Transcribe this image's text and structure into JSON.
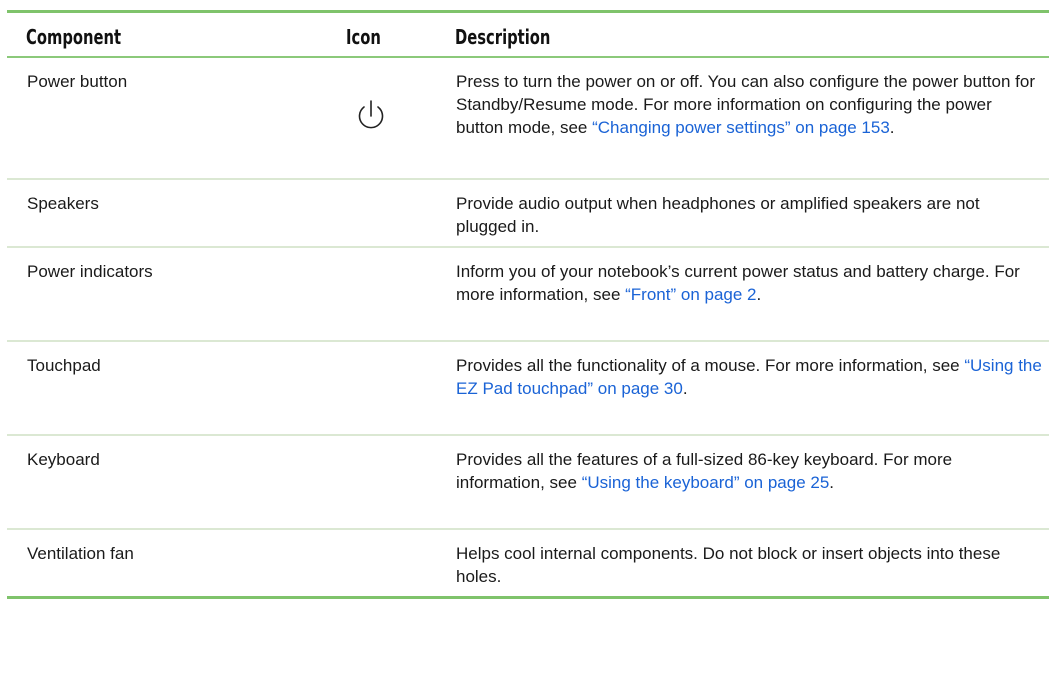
{
  "header": {
    "component": "Component",
    "icon": "Icon",
    "description": "Description"
  },
  "rows": [
    {
      "component": "Power button",
      "icon": "power-icon",
      "desc_text": "Press to turn the power on or off. You can also configure the power button for Standby/Resume mode. For more information on configuring the power button mode, see ",
      "desc_link": "“Changing power settings” on page 153",
      "desc_end": "."
    },
    {
      "component": "Speakers",
      "desc_text": "Provide audio output when headphones or amplified speakers are not plugged in."
    },
    {
      "component": "Power indicators",
      "desc_text": "Inform you of your notebook’s current power status and battery charge. For more information, see ",
      "desc_link": "“Front” on page 2",
      "desc_end": "."
    },
    {
      "component": "Touchpad",
      "desc_text": "Provides all the functionality of a mouse. For more information, see ",
      "desc_link": "“Using the EZ Pad touchpad” on page 30",
      "desc_end": "."
    },
    {
      "component": "Keyboard",
      "desc_text": "Provides all the features of a full-sized 86-key keyboard. For more information, see ",
      "desc_link": "“Using the keyboard” on page 25",
      "desc_end": "."
    },
    {
      "component": "Ventilation fan",
      "desc_text": "Helps cool internal components. Do not block or insert objects into these holes."
    }
  ],
  "colors": {
    "rule": "#7fc36b",
    "row_divider": "#dbe8d3",
    "link": "#1a63d6"
  }
}
